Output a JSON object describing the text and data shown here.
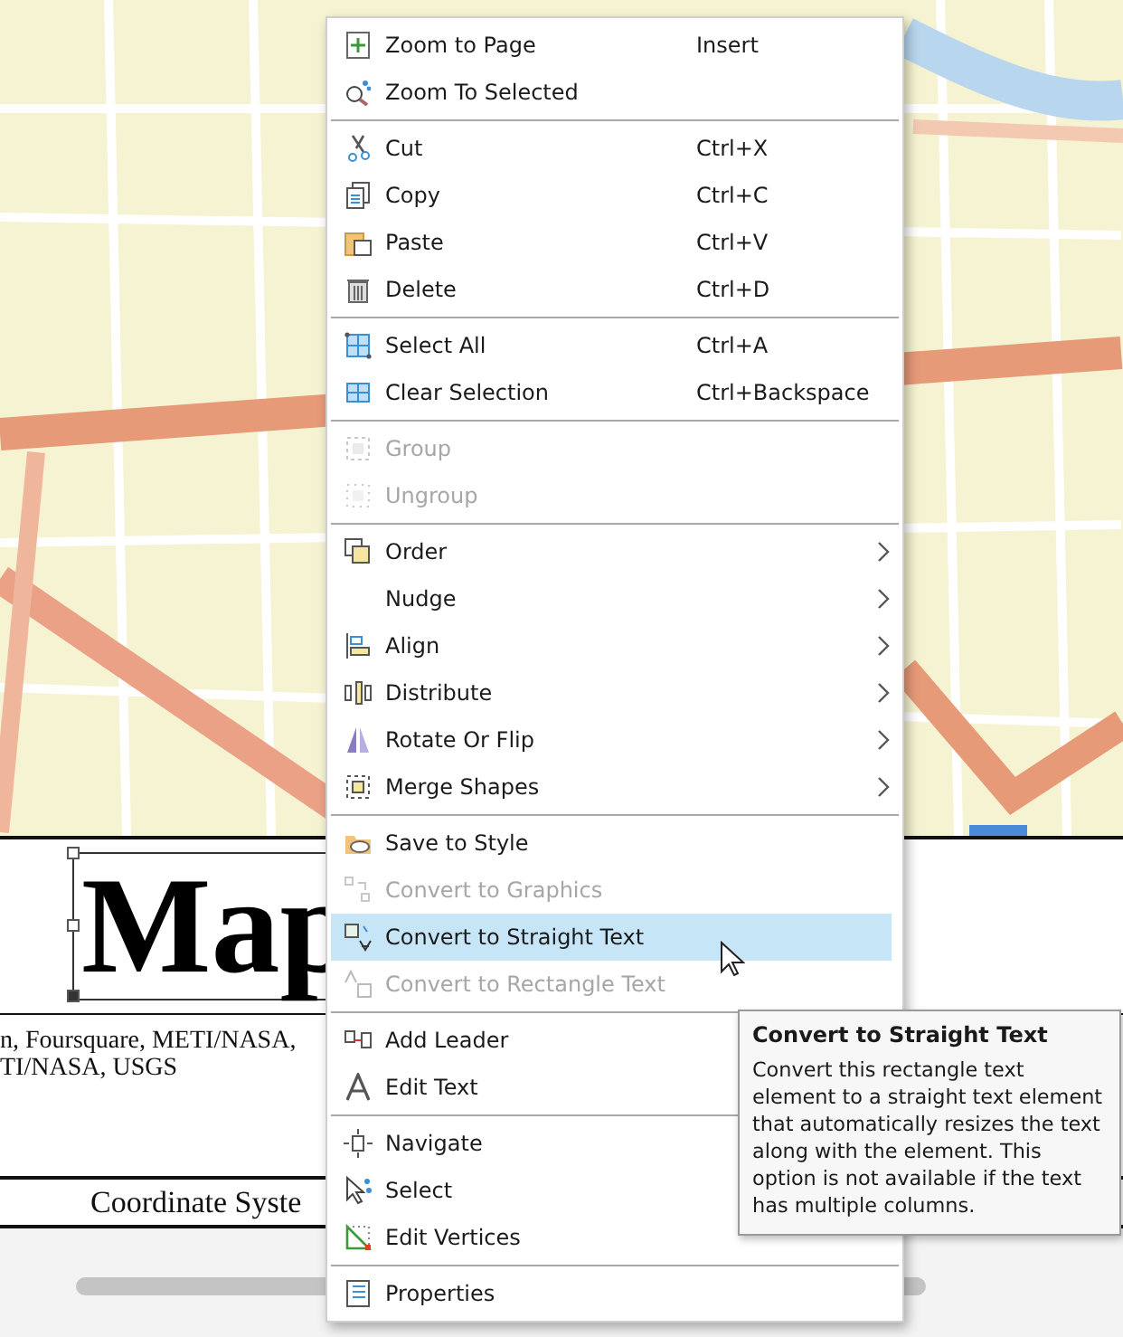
{
  "layout": {
    "title": "Map",
    "credits": [
      "n, Foursquare, METI/NASA,",
      "TI/NASA, USGS"
    ],
    "coordinate_system": "Coordinate Syste"
  },
  "context_menu": [
    {
      "kind": "item",
      "label": "Zoom to Page",
      "shortcut": "Insert",
      "disabled": false,
      "submenu": false,
      "selected": false
    },
    {
      "kind": "item",
      "label": "Zoom To Selected",
      "disabled": false,
      "submenu": false,
      "selected": false
    },
    {
      "kind": "separator"
    },
    {
      "kind": "item",
      "label": "Cut",
      "shortcut": "Ctrl+X",
      "disabled": false,
      "submenu": false,
      "selected": false
    },
    {
      "kind": "item",
      "label": "Copy",
      "shortcut": "Ctrl+C",
      "disabled": false,
      "submenu": false,
      "selected": false
    },
    {
      "kind": "item",
      "label": "Paste",
      "shortcut": "Ctrl+V",
      "disabled": false,
      "submenu": false,
      "selected": false
    },
    {
      "kind": "item",
      "label": "Delete",
      "shortcut": "Ctrl+D",
      "disabled": false,
      "submenu": false,
      "selected": false
    },
    {
      "kind": "separator"
    },
    {
      "kind": "item",
      "label": "Select All",
      "shortcut": "Ctrl+A",
      "disabled": false,
      "submenu": false,
      "selected": false
    },
    {
      "kind": "item",
      "label": "Clear Selection",
      "shortcut": "Ctrl+Backspace",
      "disabled": false,
      "submenu": false,
      "selected": false
    },
    {
      "kind": "separator"
    },
    {
      "kind": "item",
      "label": "Group",
      "disabled": true,
      "submenu": false,
      "selected": false
    },
    {
      "kind": "item",
      "label": "Ungroup",
      "disabled": true,
      "submenu": false,
      "selected": false
    },
    {
      "kind": "separator"
    },
    {
      "kind": "item",
      "label": "Order",
      "disabled": false,
      "submenu": true,
      "selected": false
    },
    {
      "kind": "item",
      "label": "Nudge",
      "disabled": false,
      "submenu": true,
      "selected": false
    },
    {
      "kind": "item",
      "label": "Align",
      "disabled": false,
      "submenu": true,
      "selected": false
    },
    {
      "kind": "item",
      "label": "Distribute",
      "disabled": false,
      "submenu": true,
      "selected": false
    },
    {
      "kind": "item",
      "label": "Rotate Or Flip",
      "disabled": false,
      "submenu": true,
      "selected": false
    },
    {
      "kind": "item",
      "label": "Merge Shapes",
      "disabled": false,
      "submenu": true,
      "selected": false
    },
    {
      "kind": "separator"
    },
    {
      "kind": "item",
      "label": "Save to Style",
      "disabled": false,
      "submenu": false,
      "selected": false
    },
    {
      "kind": "item",
      "label": "Convert to Graphics",
      "disabled": true,
      "submenu": false,
      "selected": false
    },
    {
      "kind": "item",
      "label": "Convert to Straight Text",
      "disabled": false,
      "submenu": false,
      "selected": true
    },
    {
      "kind": "item",
      "label": "Convert to Rectangle Text",
      "disabled": true,
      "submenu": false,
      "selected": false
    },
    {
      "kind": "separator"
    },
    {
      "kind": "item",
      "label": "Add Leader",
      "disabled": false,
      "selected": false
    },
    {
      "kind": "item",
      "label": "Edit Text",
      "disabled": false,
      "selected": false
    },
    {
      "kind": "separator"
    },
    {
      "kind": "item",
      "label": "Navigate",
      "disabled": false,
      "selected": false
    },
    {
      "kind": "item",
      "label": "Select",
      "disabled": false,
      "selected": false
    },
    {
      "kind": "item",
      "label": "Edit Vertices",
      "disabled": false,
      "submenu": false,
      "selected": false
    },
    {
      "kind": "separator"
    },
    {
      "kind": "item",
      "label": "Properties",
      "disabled": false,
      "submenu": false,
      "selected": false
    }
  ],
  "tooltip": {
    "title": "Convert to Straight Text",
    "body": "Convert this rectangle text element to a straight text element that automatically resizes the text along with the element. This option is not available if the text has multiple columns."
  }
}
